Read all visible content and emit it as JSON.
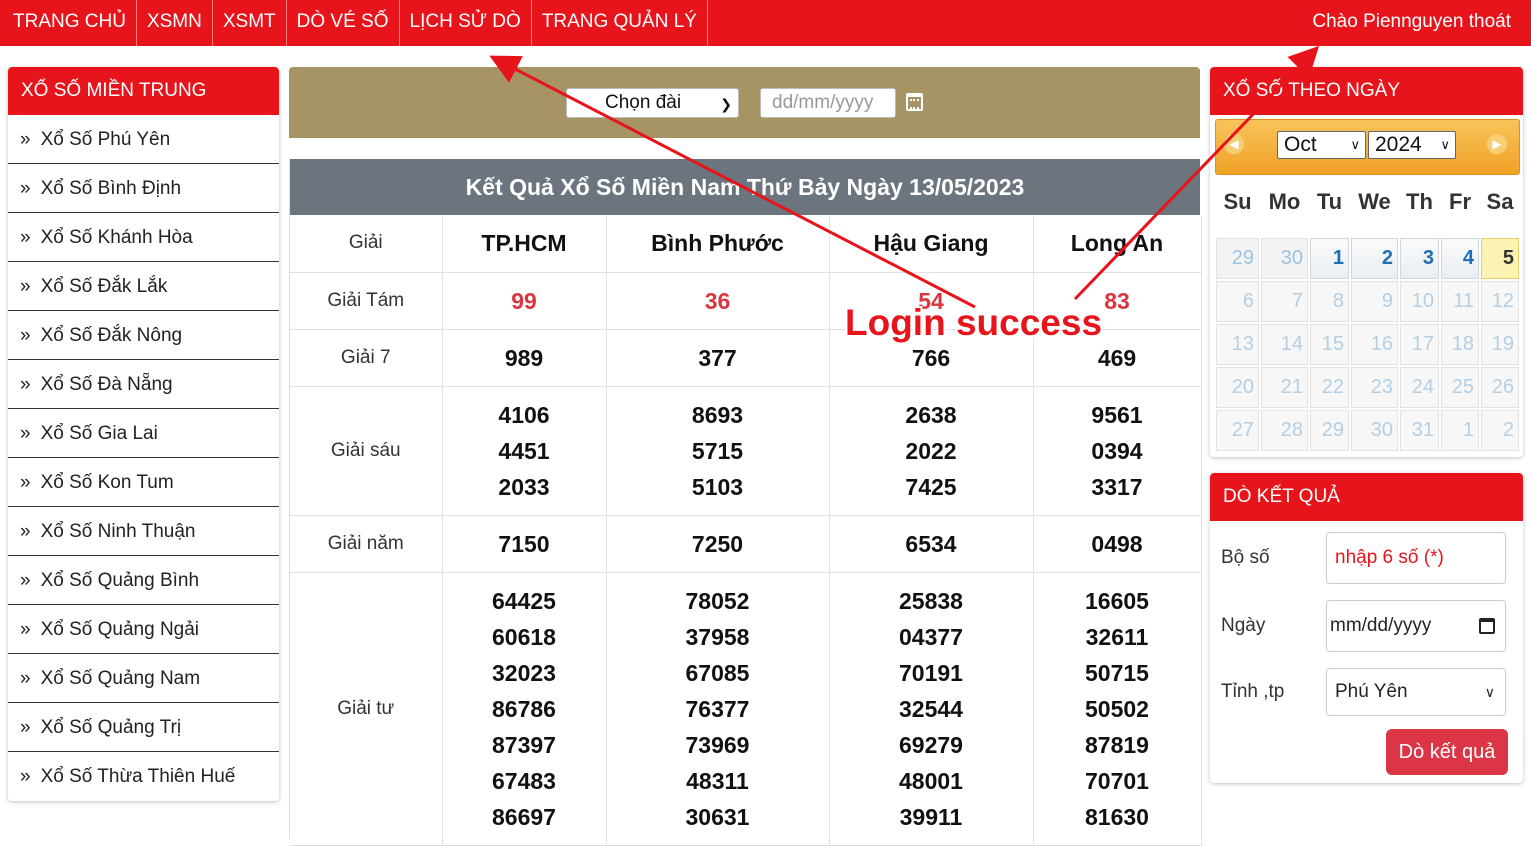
{
  "topnav": {
    "items": [
      "TRANG CHỦ",
      "XSMN",
      "XSMT",
      "DÒ VÉ SỐ",
      "LỊCH SỬ DÒ",
      "TRANG QUẢN LÝ"
    ],
    "greeting": "Chào Piennguyen",
    "logout": "thoát"
  },
  "left": {
    "title": "XỔ SỐ MIỀN TRUNG",
    "items": [
      "Xổ Số Phú Yên",
      "Xổ Số Bình Định",
      "Xổ Số Khánh Hòa",
      "Xổ Số Đắk Lắk",
      "Xổ Số Đắk Nông",
      "Xổ Số Đà Nẵng",
      "Xổ Số Gia Lai",
      "Xổ Số Kon Tum",
      "Xổ Số Ninh Thuận",
      "Xổ Số Quảng Bình",
      "Xổ Số Quảng Ngải",
      "Xổ Số Quảng Nam",
      "Xổ Số Quảng Trị",
      "Xổ Số Thừa Thiên Huế"
    ],
    "bullet": "»"
  },
  "filter": {
    "select_dai": "Chọn đài",
    "date_placeholder": "dd/mm/yyyy",
    "background": "#a79464"
  },
  "result": {
    "title": "Kết Quả Xổ Số Miền Nam Thứ Bảy Ngày 13/05/2023",
    "header": [
      "Giải",
      "TP.HCM",
      "Bình Phước",
      "Hậu Giang",
      "Long An"
    ],
    "rows": [
      {
        "label": "Giải Tám",
        "values": [
          [
            "99"
          ],
          [
            "36"
          ],
          [
            "54"
          ],
          [
            "83"
          ]
        ],
        "red": true
      },
      {
        "label": "Giải 7",
        "values": [
          [
            "989"
          ],
          [
            "377"
          ],
          [
            "766"
          ],
          [
            "469"
          ]
        ]
      },
      {
        "label": "Giải sáu",
        "values": [
          [
            "4106",
            "4451",
            "2033"
          ],
          [
            "8693",
            "5715",
            "5103"
          ],
          [
            "2638",
            "2022",
            "7425"
          ],
          [
            "9561",
            "0394",
            "3317"
          ]
        ]
      },
      {
        "label": "Giải năm",
        "values": [
          [
            "7150"
          ],
          [
            "7250"
          ],
          [
            "6534"
          ],
          [
            "0498"
          ]
        ]
      },
      {
        "label": "Giải tư",
        "values": [
          [
            "64425",
            "60618",
            "32023",
            "86786",
            "87397",
            "67483",
            "86697"
          ],
          [
            "78052",
            "37958",
            "67085",
            "76377",
            "73969",
            "48311",
            "30631"
          ],
          [
            "25838",
            "04377",
            "70191",
            "32544",
            "69279",
            "48001",
            "39911"
          ],
          [
            "16605",
            "32611",
            "50715",
            "50502",
            "87819",
            "70701",
            "81630"
          ]
        ]
      }
    ]
  },
  "calendar_panel": {
    "title": "XỔ SỐ THEO NGÀY",
    "month": "Oct",
    "year": "2024",
    "prev_icon": "arrow-left-icon",
    "next_icon": "arrow-right-icon",
    "dow": [
      "Su",
      "Mo",
      "Tu",
      "We",
      "Th",
      "Fr",
      "Sa"
    ],
    "weeks": [
      [
        {
          "d": "29",
          "t": "prevm"
        },
        {
          "d": "30",
          "t": "prevm"
        },
        {
          "d": "1",
          "t": "cur"
        },
        {
          "d": "2",
          "t": "cur"
        },
        {
          "d": "3",
          "t": "cur"
        },
        {
          "d": "4",
          "t": "cur"
        },
        {
          "d": "5",
          "t": "today"
        }
      ],
      [
        {
          "d": "6",
          "t": "future"
        },
        {
          "d": "7",
          "t": "future"
        },
        {
          "d": "8",
          "t": "future"
        },
        {
          "d": "9",
          "t": "future"
        },
        {
          "d": "10",
          "t": "future"
        },
        {
          "d": "11",
          "t": "future"
        },
        {
          "d": "12",
          "t": "future"
        }
      ],
      [
        {
          "d": "13",
          "t": "future"
        },
        {
          "d": "14",
          "t": "future"
        },
        {
          "d": "15",
          "t": "future"
        },
        {
          "d": "16",
          "t": "future"
        },
        {
          "d": "17",
          "t": "future"
        },
        {
          "d": "18",
          "t": "future"
        },
        {
          "d": "19",
          "t": "future"
        }
      ],
      [
        {
          "d": "20",
          "t": "future"
        },
        {
          "d": "21",
          "t": "future"
        },
        {
          "d": "22",
          "t": "future"
        },
        {
          "d": "23",
          "t": "future"
        },
        {
          "d": "24",
          "t": "future"
        },
        {
          "d": "25",
          "t": "future"
        },
        {
          "d": "26",
          "t": "future"
        }
      ],
      [
        {
          "d": "27",
          "t": "future"
        },
        {
          "d": "28",
          "t": "future"
        },
        {
          "d": "29",
          "t": "future"
        },
        {
          "d": "30",
          "t": "future"
        },
        {
          "d": "31",
          "t": "future"
        },
        {
          "d": "1",
          "t": "future"
        },
        {
          "d": "2",
          "t": "future"
        }
      ]
    ]
  },
  "check_panel": {
    "title": "DÒ KẾT QUẢ",
    "bo_so_label": "Bộ số",
    "bo_so_placeholder": "nhập 6 số (*)",
    "ngay_label": "Ngày",
    "ngay_placeholder": "mm/dd/yyyy",
    "tinh_label": "Tỉnh ,tp",
    "tinh_value": "Phú Yên",
    "button": "Dò kết quả"
  },
  "annotation": {
    "text": "Login success",
    "color": "#e7141b"
  },
  "colors": {
    "brand_red": "#e7141b",
    "title_gray": "#6c757d",
    "button_red": "#dc3545"
  }
}
